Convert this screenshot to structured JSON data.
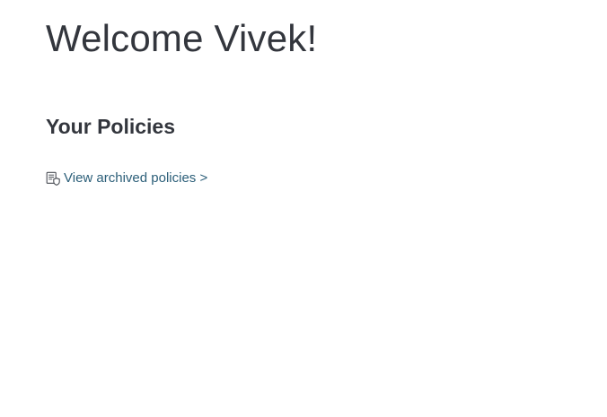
{
  "header": {
    "welcome_text": "Welcome Vivek!"
  },
  "policies": {
    "section_title": "Your Policies",
    "archived_link": {
      "label": "View archived policies >",
      "icon": "archived-policy-document-icon"
    }
  },
  "colors": {
    "text": "#33363d",
    "link": "#2c5f79",
    "background": "#ffffff"
  }
}
